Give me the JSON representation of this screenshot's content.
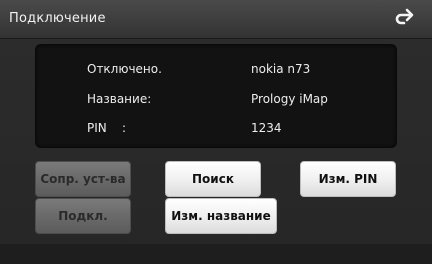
{
  "header": {
    "title": "Подключение",
    "back_icon": "back-arrow-icon"
  },
  "info": {
    "rows": [
      {
        "label": "Отключено.",
        "value": "nokia n73"
      },
      {
        "label": "Название:",
        "value": "Prology iMap"
      },
      {
        "label": "PIN    :",
        "value": "1234"
      }
    ]
  },
  "buttons": {
    "paired_devices": "Сопр. уст-ва",
    "search": "Поиск",
    "change_pin": "Изм. PIN",
    "connect": "Подкл.",
    "change_name": "Изм. название"
  },
  "colors": {
    "background": "#2b2b2b",
    "panel": "#121212",
    "button_active": "#f1f1f1",
    "button_disabled": "#6a6a6a"
  }
}
